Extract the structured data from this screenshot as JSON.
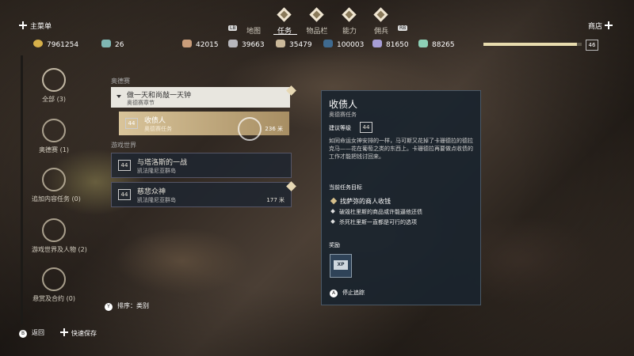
{
  "topbar": {
    "left_label": "主菜单",
    "right_label": "商店",
    "lb": "LB",
    "rb": "RB",
    "tabs": [
      {
        "label": "地图",
        "active": false
      },
      {
        "label": "任务",
        "active": true
      },
      {
        "label": "物品栏",
        "active": false
      },
      {
        "label": "能力",
        "active": false
      },
      {
        "label": "佣兵",
        "active": false
      }
    ]
  },
  "resources": {
    "drachmae": "7961254",
    "ability_points": "26",
    "items": [
      "42015",
      "39663",
      "35479",
      "100003",
      "81650",
      "88265"
    ],
    "player_level": "46",
    "xp_fraction": 0.95
  },
  "categories": [
    {
      "label": "全部 (3)",
      "icon": "all-quests-icon"
    },
    {
      "label": "奥德赛 (1)",
      "icon": "odyssey-icon"
    },
    {
      "label": "追加内容任务 (0)",
      "icon": "dlc-icon"
    },
    {
      "label": "游戏世界及人物 (2)",
      "icon": "world-icon"
    },
    {
      "label": "悬赏及合约 (0)",
      "icon": "contracts-icon"
    }
  ],
  "quest_list": {
    "section_odyssey": "奥德赛",
    "group_title": "做一天和尚敲一天钟",
    "group_subtitle": "奥德赛章节",
    "section_world": "游戏世界",
    "quests": [
      {
        "level": "44",
        "name": "收债人",
        "sub": "奥德赛任务",
        "dist": "236 米",
        "selected": true
      },
      {
        "level": "44",
        "name": "与塔洛斯的一战",
        "sub": "凯法隆尼亚群岛",
        "dist": "",
        "selected": false
      },
      {
        "level": "44",
        "name": "慈悲众神",
        "sub": "凯法隆尼亚群岛",
        "dist": "177 米",
        "selected": false
      }
    ]
  },
  "detail": {
    "title": "收债人",
    "subtitle": "奥德赛任务",
    "level_label": "建议等级",
    "level": "44",
    "description": "如同命运女神安排的一样，马可斯又花掉了卡珊德拉的德拉克马——花在葡萄之类的东西上。卡珊德拉再要做点收债的工作才能把钱讨回来。",
    "objectives_header": "当前任务目标",
    "main_objective": "找萨弥的商人收钱",
    "sub_objectives": [
      "破毁杜里斯的商品或许能逼他还债",
      "杀死杜里斯一直都是可行的选项"
    ],
    "rewards_header": "奖励",
    "reward_label": "XP",
    "track_button": "A",
    "track_label": "停止追踪"
  },
  "bottom": {
    "sort_button": "Y",
    "sort_label": "排序：类别",
    "back_button": "B",
    "back_label": "返回",
    "quicksave_label": "快速保存"
  }
}
